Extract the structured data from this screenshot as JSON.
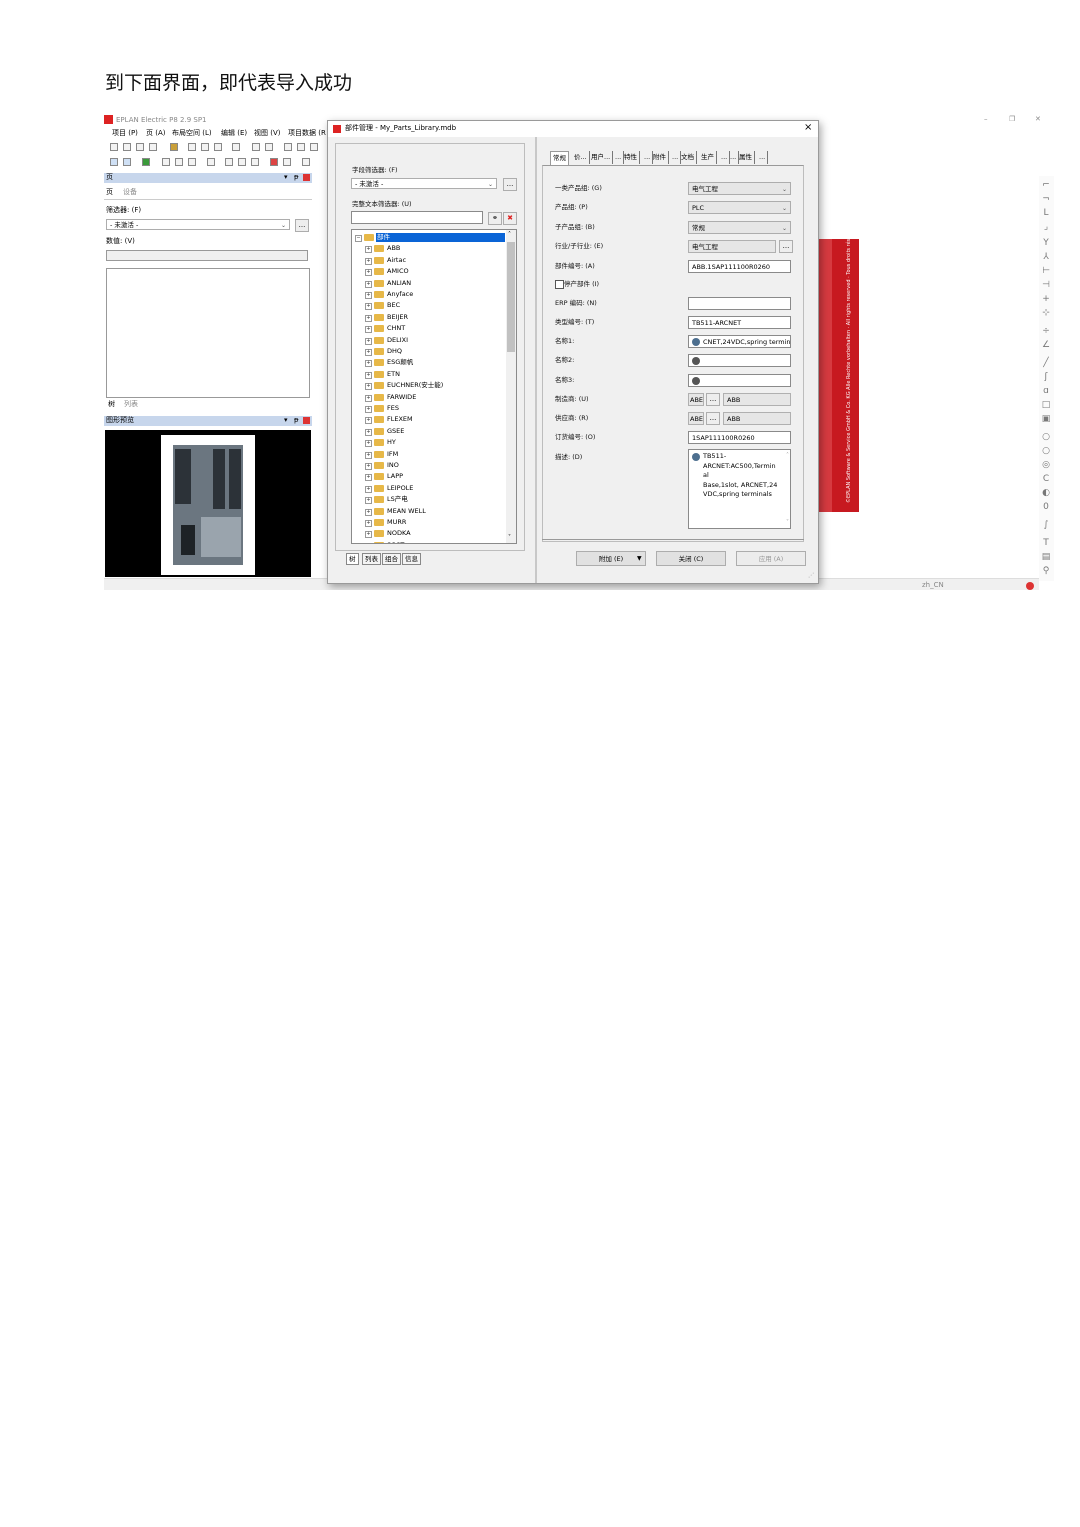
{
  "caption": "到下面界面，即代表导入成功",
  "main": {
    "title": "EPLAN Electric P8 2.9 SP1",
    "menus": [
      "项目 (P)",
      "页 (A)",
      "布局空间 (L)",
      "编辑 (E)",
      "视图 (V)",
      "项目数据 (R"
    ],
    "pages_panel": {
      "title": "页",
      "tabs": [
        "页",
        "设备"
      ],
      "filter_label": "筛选器: (F)",
      "filter_value": "- 未激活 -",
      "value_label": "数值: (V)",
      "bottom_tabs": [
        "树",
        "列表"
      ]
    },
    "preview_panel": {
      "title": "图形预览"
    },
    "red_box_text": "©EPLAN Software & Service GmbH & Co. KG  Alle Rechte vorbehalten · All rights reserved · Tous droits réservé",
    "status_lang": "zh_CN"
  },
  "dialog": {
    "title": "部件管理 - My_Parts_Library.mdb",
    "close": "×",
    "field_filter_label": "字段筛选器: (F)",
    "field_filter_value": "- 未激活 -",
    "fulltext_label": "完整文本筛选器: (U)",
    "tree_root": "部件",
    "tree_items": [
      "ABB",
      "Airtac",
      "AMICO",
      "ANLIAN",
      "Anyface",
      "BEC",
      "BEIJER",
      "CHNT",
      "DELIXI",
      "DHQ",
      "ESG颠帆",
      "ETN",
      "EUCHNER(安士能)",
      "FARWIDE",
      "FES",
      "FLEXEM",
      "GSEE",
      "HY",
      "IFM",
      "INO",
      "LAPP",
      "LEIPOLE",
      "LS产电",
      "MEAN WELL",
      "MURR",
      "NODKA",
      "SOST"
    ],
    "bottom_tabs": [
      "树",
      "列表",
      "组合",
      "信息"
    ],
    "tabs": [
      "常规",
      "价...",
      "用户...",
      "...",
      "特性",
      "...",
      "附件",
      "...",
      "文档",
      "生产",
      "...",
      "...",
      "属性",
      "..."
    ],
    "fields": [
      {
        "label": "一类产品组: (G)",
        "value": "电气工程",
        "kind": "combo"
      },
      {
        "label": "产品组: (P)",
        "value": "PLC",
        "kind": "combo"
      },
      {
        "label": "子产品组: (B)",
        "value": "常规",
        "kind": "combo"
      },
      {
        "label": "行业/子行业: (E)",
        "value": "电气工程",
        "kind": "text-btn"
      },
      {
        "label": "部件编号: (A)",
        "value": "ABB.1SAP111100R0260",
        "kind": "text"
      },
      {
        "label": "停产部件 (I)",
        "value": "",
        "kind": "check"
      },
      {
        "label": "ERP 编码: (N)",
        "value": "",
        "kind": "text"
      },
      {
        "label": "类型编号: (T)",
        "value": "TB511-ARCNET",
        "kind": "text"
      },
      {
        "label": "名称1:",
        "value": "CNET,24VDC,spring termin",
        "kind": "globe"
      },
      {
        "label": "名称2:",
        "value": "",
        "kind": "globe-bw"
      },
      {
        "label": "名称3:",
        "value": "",
        "kind": "globe-bw"
      },
      {
        "label": "制造商: (U)",
        "value": "ABB",
        "short": "ABE",
        "kind": "pair"
      },
      {
        "label": "供应商: (R)",
        "value": "ABB",
        "short": "ABE",
        "kind": "pair"
      },
      {
        "label": "订货编号: (O)",
        "value": "1SAP111100R0260",
        "kind": "text"
      },
      {
        "label": "描述: (D)",
        "value": "TB511-\nARCNET:AC500,Termin\nal\nBase,1slot, ARCNET,24\nVDC,spring terminals",
        "kind": "memo"
      }
    ],
    "buttons": {
      "attach": "附加 (E)",
      "close": "关闭 (C)",
      "apply": "应用 (A)"
    },
    "ellipsis": "..."
  }
}
